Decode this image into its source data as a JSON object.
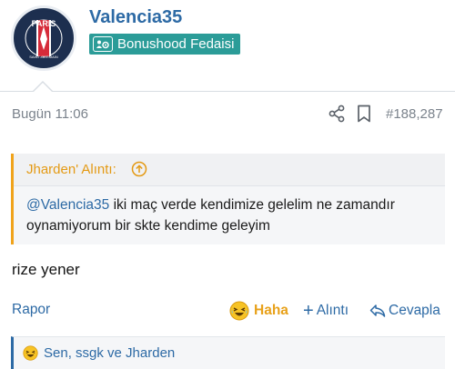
{
  "user": {
    "name": "Valencia35",
    "title": "Bonushood Fedaisi",
    "avatar_text": "PARIS",
    "avatar_subtext": "SAINT-GERMAIN"
  },
  "post": {
    "date": "Bugün 11:06",
    "number": "#188,287",
    "message": "rize yener"
  },
  "quote": {
    "author": "Jharden' Alıntı:",
    "mention": "@Valencia35",
    "text": " iki maç verde kendimize gelelim ne zamandır oynamiyorum bir skte kendime geleyim"
  },
  "actions": {
    "report": "Rapor",
    "haha": "Haha",
    "quote": "Alıntı",
    "reply": "Cevapla"
  },
  "reactions": {
    "text": "Sen, ssgk ve Jharden"
  },
  "colors": {
    "link": "#2d6aa5",
    "accent": "#f0a31b",
    "title_badge": "#2b9c98",
    "psg_navy": "#1d2f4f",
    "psg_red": "#d62b3a"
  }
}
